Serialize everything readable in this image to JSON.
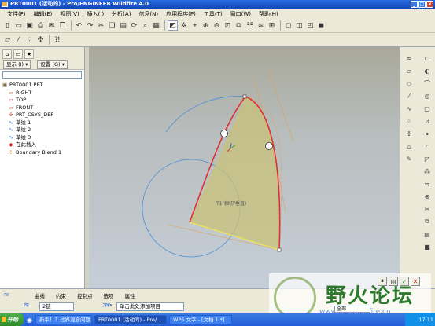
{
  "window": {
    "title": "PRT0001 (活动的) - Pro/ENGINEER Wildfire 4.0",
    "controls": [
      "_",
      "□",
      "×"
    ]
  },
  "menu": [
    "文件(F)",
    "编辑(E)",
    "视图(V)",
    "插入(I)",
    "分析(A)",
    "信息(N)",
    "应用程序(P)",
    "工具(T)",
    "窗口(W)",
    "帮助(H)"
  ],
  "toolbar1": [
    "new-icon",
    "open-icon",
    "save-icon",
    "print-icon",
    "email-icon",
    "copy-icon",
    "undo-icon",
    "redo-icon",
    "cut-icon",
    "copy-icon",
    "paste-icon",
    "regenerate-icon",
    "find-icon",
    "select-icon",
    "repaint-icon",
    "spin-center-icon",
    "orient-icon",
    "zoom-in-icon",
    "zoom-out-icon",
    "refit-icon",
    "reorient-icon",
    "saved-views-icon",
    "layers-icon",
    "view-manager-icon",
    "wireframe-icon",
    "hidden-line-icon",
    "no-hidden-icon",
    "shading-icon"
  ],
  "toolbar2": [
    "plane-icon",
    "axis-icon",
    "point-icon",
    "csys-icon",
    "help-icon"
  ],
  "left_panel": {
    "tabs": [
      "model-tree-icon",
      "folder-icon",
      "favorites-icon"
    ],
    "show_label": "显示 (I) ▾",
    "settings_label": "设置 (G) ▾",
    "tree": [
      {
        "icon": "part-icon",
        "label": "PRT0001.PRT"
      },
      {
        "icon": "datum-plane-icon",
        "label": "RIGHT"
      },
      {
        "icon": "datum-plane-icon",
        "label": "TOP"
      },
      {
        "icon": "datum-plane-icon",
        "label": "FRONT"
      },
      {
        "icon": "csys-icon",
        "label": "PRT_CSYS_DEF"
      },
      {
        "icon": "sketch-icon",
        "label": "草绘 1"
      },
      {
        "icon": "sketch-icon",
        "label": "草绘 2"
      },
      {
        "icon": "sketch-icon",
        "label": "草绘 3"
      },
      {
        "icon": "insert-here-icon",
        "label": "在此插入"
      },
      {
        "icon": "blend-icon",
        "label": "Boundary Blend 1"
      }
    ]
  },
  "viewport": {
    "annotation": "T1(相切/垂直)"
  },
  "dashboard": {
    "tabs": [
      "曲线",
      "约束",
      "控制点",
      "选项",
      "属性"
    ],
    "chain_field": "2链",
    "message_field": "单击此处添加项目",
    "filter_value": "全部"
  },
  "watermark": {
    "title": "野火论坛",
    "url": "www.proewildfire.cn"
  },
  "taskbar": {
    "start": "开始",
    "tasks": [
      "新手！？过界混合问题...",
      "PRT0001 (活动的) - Pro/...",
      "WPS 文字 - [文档 1 *]"
    ],
    "clock": "17:11"
  },
  "colors": {
    "selection": "#e03030",
    "surface": "#c9c27a",
    "datum": "#4a8fd8",
    "sketch": "#e0a050"
  }
}
